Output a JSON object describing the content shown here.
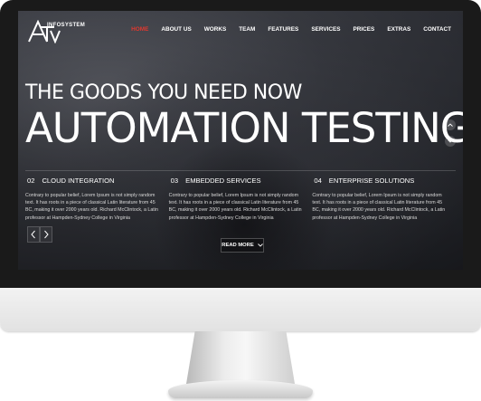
{
  "brand": {
    "logo_text": "INFOSYSTEM"
  },
  "nav": {
    "items": [
      {
        "label": "HOME",
        "active": true
      },
      {
        "label": "ABOUT US",
        "active": false
      },
      {
        "label": "WORKS",
        "active": false
      },
      {
        "label": "TEAM",
        "active": false
      },
      {
        "label": "FEATURES",
        "active": false
      },
      {
        "label": "SERVICES",
        "active": false
      },
      {
        "label": "PRICES",
        "active": false
      },
      {
        "label": "EXTRAS",
        "active": false
      },
      {
        "label": "CONTACT",
        "active": false
      }
    ]
  },
  "hero": {
    "subtitle": "THE GOODS YOU NEED NOW",
    "title": "AUTOMATION TESTING"
  },
  "services": [
    {
      "number": "02",
      "title": "CLOUD INTEGRATION",
      "text": "Contrary to popular belief, Lorem Ipsum is not simply random text. It has roots in a piece of classical Latin literature from 45 BC, making it over 2000 years old. Richard McClintock, a Latin professor at Hampden-Sydney College in Virginia"
    },
    {
      "number": "03",
      "title": "EMBEDDED SERVICES",
      "text": "Contrary to popular belief, Lorem Ipsum is not simply random text. It has roots in a piece of classical Latin literature from 45 BC, making it over 2000 years old. Richard McClintock, a Latin professor at Hampden-Sydney College in Virginia"
    },
    {
      "number": "04",
      "title": "ENTERPRISE SOLUTIONS",
      "text": "Contrary to popular belief, Lorem Ipsum is not simply random text. It has roots in a piece of classical Latin literature from 45 BC, making it over 2000 years old. Richard McClintock, a Latin professor at Hampden-Sydney College in Virginia"
    }
  ],
  "cta": {
    "read_more": "READ MORE"
  },
  "colors": {
    "accent": "#e0382f",
    "text": "#ffffff",
    "bezel": "#1a1a1a"
  },
  "icons": {
    "logo": "atv-logo",
    "prev": "chevron-left-icon",
    "next": "chevron-right-icon",
    "scroll_up": "chevron-up-icon",
    "scroll_down": "chevron-down-icon",
    "read_more": "chevron-down-icon"
  }
}
